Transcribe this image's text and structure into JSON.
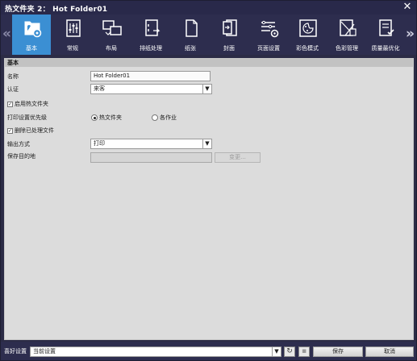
{
  "window": {
    "title": "热文件夹 2： Hot Folder01",
    "close_glyph": "✕"
  },
  "toolbar": {
    "prev_glyph": "«",
    "next_glyph": "»",
    "tabs": [
      {
        "label": "基本",
        "icon": "folder-gear-icon",
        "active": true
      },
      {
        "label": "常规",
        "icon": "sliders-icon",
        "active": false
      },
      {
        "label": "布局",
        "icon": "layout-icon",
        "active": false
      },
      {
        "label": "排纸处理",
        "icon": "finishing-icon",
        "active": false
      },
      {
        "label": "纸张",
        "icon": "paper-icon",
        "active": false
      },
      {
        "label": "封面",
        "icon": "cover-icon",
        "active": false
      },
      {
        "label": "页面设置",
        "icon": "page-setup-icon",
        "active": false
      },
      {
        "label": "彩色模式",
        "icon": "palette-icon",
        "active": false
      },
      {
        "label": "色彩管理",
        "icon": "color-management-icon",
        "active": false
      },
      {
        "label": "质量最优化",
        "icon": "quality-icon",
        "active": false
      }
    ]
  },
  "basic": {
    "section_title": "基本",
    "name_label": "名称",
    "name_value": "Hot Folder01",
    "auth_label": "认证",
    "auth_value": "来客",
    "enable_label": "启用热文件夹",
    "enable_checked": true,
    "priority_label": "打印设置优先级",
    "priority_option1": "热文件夹",
    "priority_option2": "各作业",
    "priority_selected": "热文件夹",
    "delete_label": "删除已处理文件",
    "delete_checked": true,
    "output_label": "输出方式",
    "output_value": "打印",
    "save_dest_label": "保存目的地",
    "save_dest_value": "",
    "change_button": "变更..."
  },
  "footer": {
    "favorites_label": "喜好设置",
    "favorites_value": "当前设置",
    "refresh_icon": "refresh-icon",
    "save_icon": "floppy-icon",
    "save_button": "保存",
    "cancel_button": "取消"
  },
  "colors": {
    "titlebar": "#29294a",
    "toolbar": "#2d2d4e",
    "active_tab": "#3b8fd3",
    "panel": "#dcdcdc"
  }
}
